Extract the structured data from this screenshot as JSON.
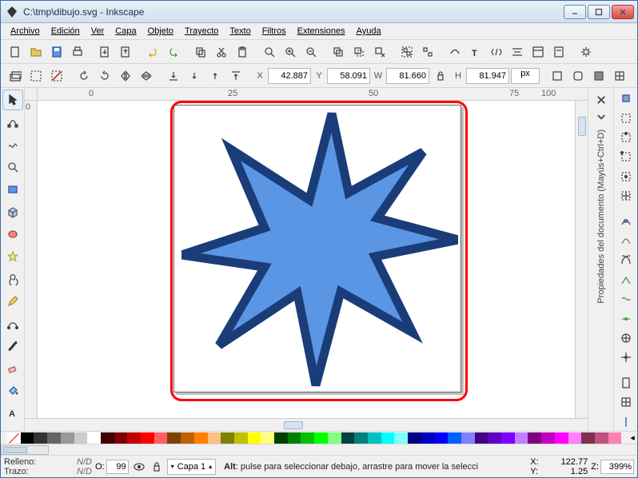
{
  "title": "C:\\tmp\\dibujo.svg - Inkscape",
  "menu": [
    "Archivo",
    "Edición",
    "Ver",
    "Capa",
    "Objeto",
    "Trayecto",
    "Texto",
    "Filtros",
    "Extensiones",
    "Ayuda"
  ],
  "coords": {
    "X": "42.887",
    "Y": "58.091",
    "W": "81.660",
    "H": "81.947",
    "unit": "px"
  },
  "ruler_h": [
    "0",
    "25",
    "50",
    "75",
    "100"
  ],
  "ruler_v": [
    "0"
  ],
  "dock_panel_label": "Propiedades del documento (Mayús+Ctrl+D)",
  "palette": [
    "none",
    "#000000",
    "#333333",
    "#666666",
    "#999999",
    "#cccccc",
    "#ffffff",
    "#400000",
    "#800000",
    "#c00000",
    "#ff0000",
    "#ff6060",
    "#804000",
    "#c06000",
    "#ff8000",
    "#ffc080",
    "#808000",
    "#c0c000",
    "#ffff00",
    "#ffff80",
    "#004000",
    "#008000",
    "#00c000",
    "#00ff00",
    "#80ff80",
    "#004040",
    "#008080",
    "#00c0c0",
    "#00ffff",
    "#80ffff",
    "#000080",
    "#0000c0",
    "#0000ff",
    "#0060ff",
    "#8080ff",
    "#400080",
    "#6000c0",
    "#8000ff",
    "#c080ff",
    "#800080",
    "#c000c0",
    "#ff00ff",
    "#ff80ff",
    "#803050",
    "#c05080",
    "#ff80b0"
  ],
  "status": {
    "fill_label": "Relleno:",
    "stroke_label": "Trazo:",
    "fill_value": "N/D",
    "stroke_value": "N/D",
    "opacity_label": "O:",
    "opacity_value": "99",
    "layer": "Capa 1",
    "message": "Alt: pulse para seleccionar debajo, arrastre para mover la selecci",
    "x_label": "X:",
    "y_label": "Y:",
    "x_value": "122.77",
    "y_value": "1.25",
    "z_label": "Z:",
    "zoom": "399%"
  },
  "shape": {
    "fill": "#5a96e3",
    "stroke": "#1a3d7a"
  }
}
